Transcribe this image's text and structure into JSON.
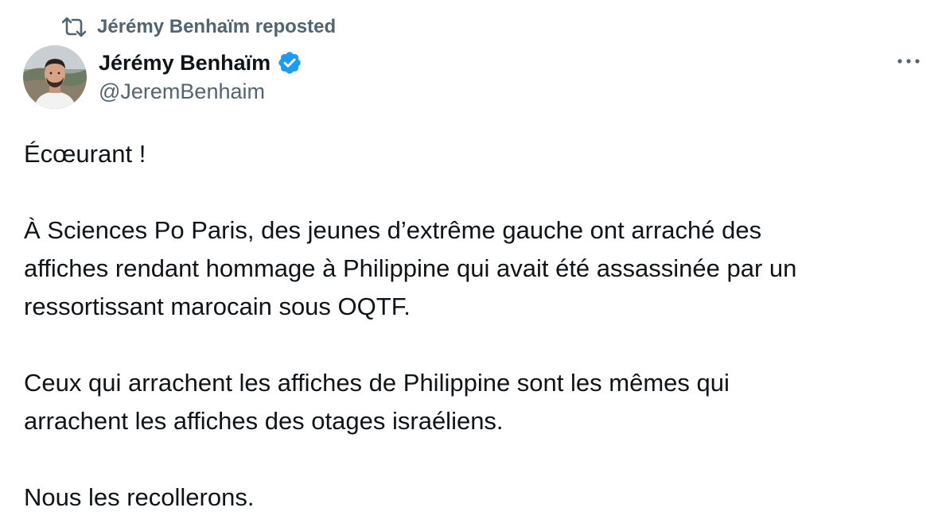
{
  "repost": {
    "label": "Jérémy Benhaïm reposted",
    "icon": "repost-icon"
  },
  "author": {
    "name": "Jérémy Benhaïm",
    "handle": "@JeremBenhaim",
    "verified": true,
    "verified_color": "#1d9bf0",
    "avatar_icon": "avatar-photo"
  },
  "more_icon": "more-horizontal-icon",
  "tweet": {
    "paragraphs": [
      [
        "Écœurant !"
      ],
      [
        "À Sciences Po Paris, des jeunes d’extrême gauche ont arraché des",
        "affiches rendant hommage à Philippine qui avait été assassinée par un",
        "ressortissant marocain sous OQTF."
      ],
      [
        "Ceux qui arrachent les affiches de Philippine sont les mêmes qui",
        "arrachent les affiches des otages israéliens."
      ],
      [
        "Nous les recollerons."
      ]
    ]
  },
  "colors": {
    "text_primary": "#0f1419",
    "text_secondary": "#536471",
    "accent": "#1d9bf0"
  }
}
